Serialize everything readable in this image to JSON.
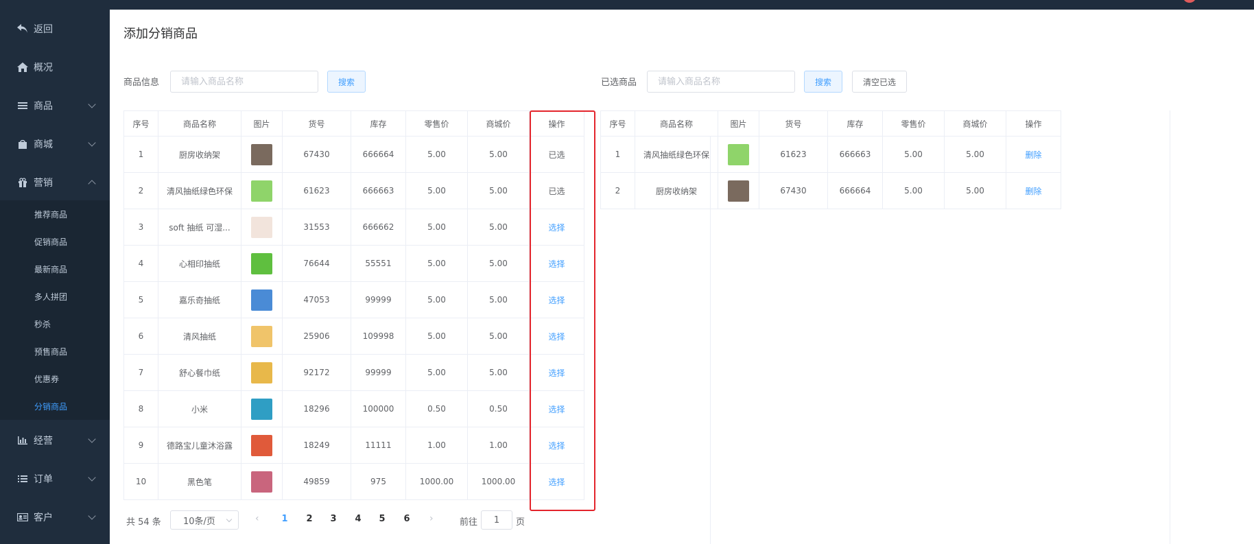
{
  "sidebar": {
    "back": "返回",
    "overview": "概况",
    "goods": "商品",
    "mall": "商城",
    "marketing": "营销",
    "sub": [
      "推荐商品",
      "促销商品",
      "最新商品",
      "多人拼团",
      "秒杀",
      "预售商品",
      "优惠券",
      "分销商品"
    ],
    "operation": "经营",
    "orders": "订单",
    "customers": "客户"
  },
  "page": {
    "title": "添加分销商品"
  },
  "left": {
    "label": "商品信息",
    "placeholder": "请输入商品名称",
    "search": "搜索",
    "headers": [
      "序号",
      "商品名称",
      "图片",
      "货号",
      "库存",
      "零售价",
      "商城价",
      "操作"
    ],
    "rows": [
      {
        "no": "1",
        "name": "厨房收纳架",
        "sku": "67430",
        "stock": "666664",
        "retail": "5.00",
        "mall": "5.00",
        "op": "已选",
        "img": "#7a6a5e"
      },
      {
        "no": "2",
        "name": "清风抽纸绿色环保",
        "sku": "61623",
        "stock": "666663",
        "retail": "5.00",
        "mall": "5.00",
        "op": "已选",
        "img": "#8fd46a"
      },
      {
        "no": "3",
        "name": "soft 抽纸 可湿...",
        "sku": "31553",
        "stock": "666662",
        "retail": "5.00",
        "mall": "5.00",
        "op": "选择",
        "img": "#f2e4dc"
      },
      {
        "no": "4",
        "name": "心相印抽纸",
        "sku": "76644",
        "stock": "55551",
        "retail": "5.00",
        "mall": "5.00",
        "op": "选择",
        "img": "#5fbf3f"
      },
      {
        "no": "5",
        "name": "嘉乐奇抽纸",
        "sku": "47053",
        "stock": "99999",
        "retail": "5.00",
        "mall": "5.00",
        "op": "选择",
        "img": "#4a8bd6"
      },
      {
        "no": "6",
        "name": "清风抽纸",
        "sku": "25906",
        "stock": "109998",
        "retail": "5.00",
        "mall": "5.00",
        "op": "选择",
        "img": "#f0c46a"
      },
      {
        "no": "7",
        "name": "舒心餐巾纸",
        "sku": "92172",
        "stock": "99999",
        "retail": "5.00",
        "mall": "5.00",
        "op": "选择",
        "img": "#e8b84a"
      },
      {
        "no": "8",
        "name": "小米",
        "sku": "18296",
        "stock": "100000",
        "retail": "0.50",
        "mall": "0.50",
        "op": "选择",
        "img": "#2f9ec4"
      },
      {
        "no": "9",
        "name": "德路宝儿童沐浴露",
        "sku": "18249",
        "stock": "11111",
        "retail": "1.00",
        "mall": "1.00",
        "op": "选择",
        "img": "#e05a3a"
      },
      {
        "no": "10",
        "name": "黑色笔",
        "sku": "49859",
        "stock": "975",
        "retail": "1000.00",
        "mall": "1000.00",
        "op": "选择",
        "img": "#c9657d"
      }
    ]
  },
  "right": {
    "label": "已选商品",
    "placeholder": "请输入商品名称",
    "search": "搜索",
    "clear": "清空已选",
    "headers": [
      "序号",
      "商品名称",
      "图片",
      "货号",
      "库存",
      "零售价",
      "商城价",
      "操作"
    ],
    "rows": [
      {
        "no": "1",
        "name": "清风抽纸绿色环保",
        "sku": "61623",
        "stock": "666663",
        "retail": "5.00",
        "mall": "5.00",
        "op": "删除",
        "img": "#8fd46a"
      },
      {
        "no": "2",
        "name": "厨房收纳架",
        "sku": "67430",
        "stock": "666664",
        "retail": "5.00",
        "mall": "5.00",
        "op": "删除",
        "img": "#7a6a5e"
      }
    ]
  },
  "pagination": {
    "total": "共 54 条",
    "page_size": "10条/页",
    "prev": "‹",
    "next": "›",
    "pages": [
      "1",
      "2",
      "3",
      "4",
      "5",
      "6"
    ],
    "current": "1",
    "goto_label": "前往",
    "goto_value": "1",
    "goto_suffix": "页"
  },
  "colors": {
    "accent": "#409eff",
    "sidebar": "#1f2d3d",
    "highlight": "#e3242b"
  }
}
